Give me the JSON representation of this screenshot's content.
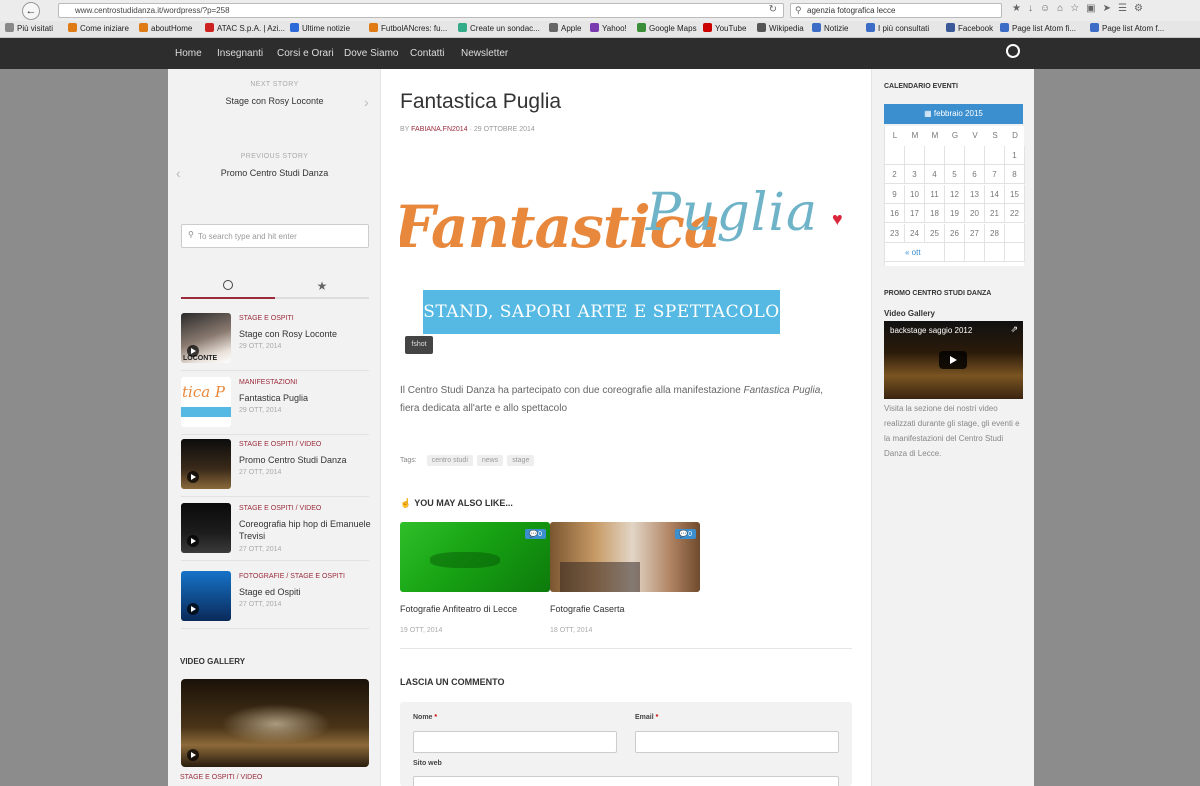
{
  "browser": {
    "url": "www.centrostudidanza.it/wordpress/?p=258",
    "search": "agenzia fotografica lecce",
    "bookmarks": [
      "Più visitati",
      "Come iniziare",
      "aboutHome",
      "ATAC S.p.A. | Azi...",
      "Ultime notizie",
      "FutbolANcres: fu...",
      "Create un sondac...",
      "Apple",
      "Yahoo!",
      "Google Maps",
      "YouTube",
      "Wikipedia",
      "Notizie",
      "I più consultati",
      "Facebook",
      "Page list Atom fi...",
      "Page list Atom f..."
    ]
  },
  "nav": {
    "items": [
      "Home",
      "Insegnanti",
      "Corsi e Orari",
      "Dove Siamo",
      "Contatti",
      "Newsletter"
    ]
  },
  "left": {
    "next_label": "NEXT STORY",
    "next_title": "Stage con Rosy Loconte",
    "prev_label": "PREVIOUS STORY",
    "prev_title": "Promo Centro Studi Danza",
    "search_placeholder": "To search type and hit enter",
    "posts": [
      {
        "cat": "STAGE E OSPITI",
        "title": "Stage con Rosy Loconte",
        "date": "29 OTT, 2014",
        "thumb_text": "LOCONTE"
      },
      {
        "cat": "MANIFESTAZIONI",
        "title": "Fantastica Puglia",
        "date": "29 OTT, 2014",
        "thumb_text": "tica P"
      },
      {
        "cat": "STAGE E OSPITI / VIDEO",
        "title": "Promo Centro Studi Danza",
        "date": "27 OTT, 2014",
        "thumb_text": ""
      },
      {
        "cat": "STAGE E OSPITI / VIDEO",
        "title": "Coreografia hip hop di Emanuele Trevisi",
        "date": "27 OTT, 2014",
        "thumb_text": ""
      },
      {
        "cat": "FOTOGRAFIE / STAGE E OSPITI",
        "title": "Stage ed Ospiti",
        "date": "27 OTT, 2014",
        "thumb_text": ""
      }
    ],
    "video_gallery": "VIDEO GALLERY",
    "video_caption": "STAGE E OSPITI / VIDEO"
  },
  "article": {
    "title": "Fantastica Puglia",
    "byline_prefix": "BY",
    "author": "FABIANA.FN2014",
    "date": "29 OTTOBRE 2014",
    "banner_script": "Fantastica",
    "banner_script2": "Puglia",
    "banner_sub": "STAND, SAPORI ARTE E SPETTACOLO",
    "badge": "fshot",
    "body_pre": "Il Centro Studi Danza ha partecipato con due coreografie alla manifestazione ",
    "body_em": "Fantastica Puglia",
    "body_post": ",",
    "body_line2": "fiera dedicata all'arte e allo spettacolo",
    "tags_label": "Tags:",
    "tags": [
      "centro studi",
      "news",
      "stage"
    ],
    "related_heading": "YOU MAY ALSO LIKE...",
    "related": [
      {
        "title": "Fotografie Anfiteatro di Lecce",
        "date": "19 OTT, 2014",
        "comments": "0"
      },
      {
        "title": "Fotografie Caserta",
        "date": "18 OTT, 2014",
        "comments": "0"
      }
    ],
    "comment_heading": "LASCIA UN COMMENTO",
    "name_label": "Nome",
    "email_label": "Email",
    "site_label": "Sito web"
  },
  "right": {
    "cal_heading": "CALENDARIO EVENTI",
    "cal_month": "febbraio 2015",
    "cal_days": [
      "L",
      "M",
      "M",
      "G",
      "V",
      "S",
      "D"
    ],
    "cal_rows": [
      [
        "",
        "",
        "",
        "",
        "",
        "",
        "1"
      ],
      [
        "2",
        "3",
        "4",
        "5",
        "6",
        "7",
        "8"
      ],
      [
        "9",
        "10",
        "11",
        "12",
        "13",
        "14",
        "15"
      ],
      [
        "16",
        "17",
        "18",
        "19",
        "20",
        "21",
        "22"
      ],
      [
        "23",
        "24",
        "25",
        "26",
        "27",
        "28",
        ""
      ]
    ],
    "cal_prev": "« ott",
    "promo_heading": "PROMO CENTRO STUDI DANZA",
    "video_gallery": "Video Gallery",
    "video_title": "backstage saggio 2012",
    "promo_text": "Visita la sezione dei nostri video realizzati durante gli stage, gli eventi e la manifestazioni del Centro Studi Danza di Lecce."
  },
  "colors": {
    "accent": "#3b8fcf",
    "cat": "#9a2b3b",
    "nav": "#2d2d2d"
  }
}
